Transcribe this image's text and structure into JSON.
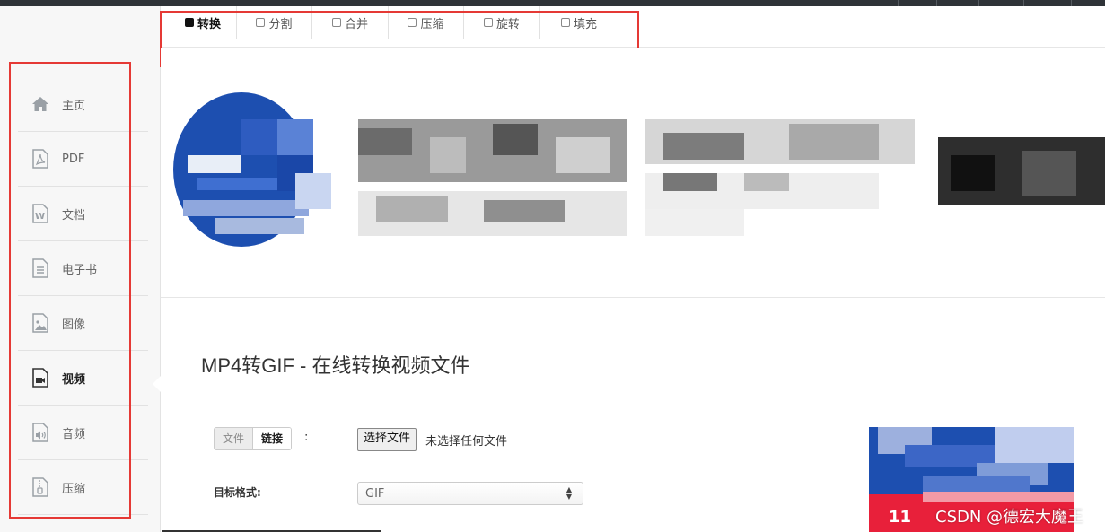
{
  "tabs": [
    {
      "label": "转换",
      "active": true
    },
    {
      "label": "分割",
      "active": false
    },
    {
      "label": "合并",
      "active": false
    },
    {
      "label": "压缩",
      "active": false
    },
    {
      "label": "旋转",
      "active": false
    },
    {
      "label": "填充",
      "active": false
    }
  ],
  "sidebar": {
    "items": [
      {
        "label": "主页",
        "icon": "home-icon"
      },
      {
        "label": "PDF",
        "icon": "pdf-file-icon"
      },
      {
        "label": "文档",
        "icon": "word-doc-icon"
      },
      {
        "label": "电子书",
        "icon": "ebook-icon"
      },
      {
        "label": "图像",
        "icon": "image-file-icon"
      },
      {
        "label": "视频",
        "icon": "video-file-icon",
        "active": true
      },
      {
        "label": "音频",
        "icon": "audio-file-icon"
      },
      {
        "label": "压缩",
        "icon": "archive-file-icon"
      }
    ]
  },
  "main": {
    "title": "MP4转GIF - 在线转换视频文件",
    "source_toggle": {
      "file": "文件",
      "link": "链接",
      "colon": ":"
    },
    "file_button": "选择文件",
    "file_status": "未选择任何文件",
    "format_label": "目标格式:",
    "format_value": "GIF"
  },
  "watermark": "CSDN @德宏大魔王",
  "side_ad_text": "11",
  "colors": {
    "highlight_box": "#e53935",
    "sidebar_bg": "#f7f7f7",
    "banner_blue": "#1d4fb0",
    "ad_red": "#e8203a"
  }
}
